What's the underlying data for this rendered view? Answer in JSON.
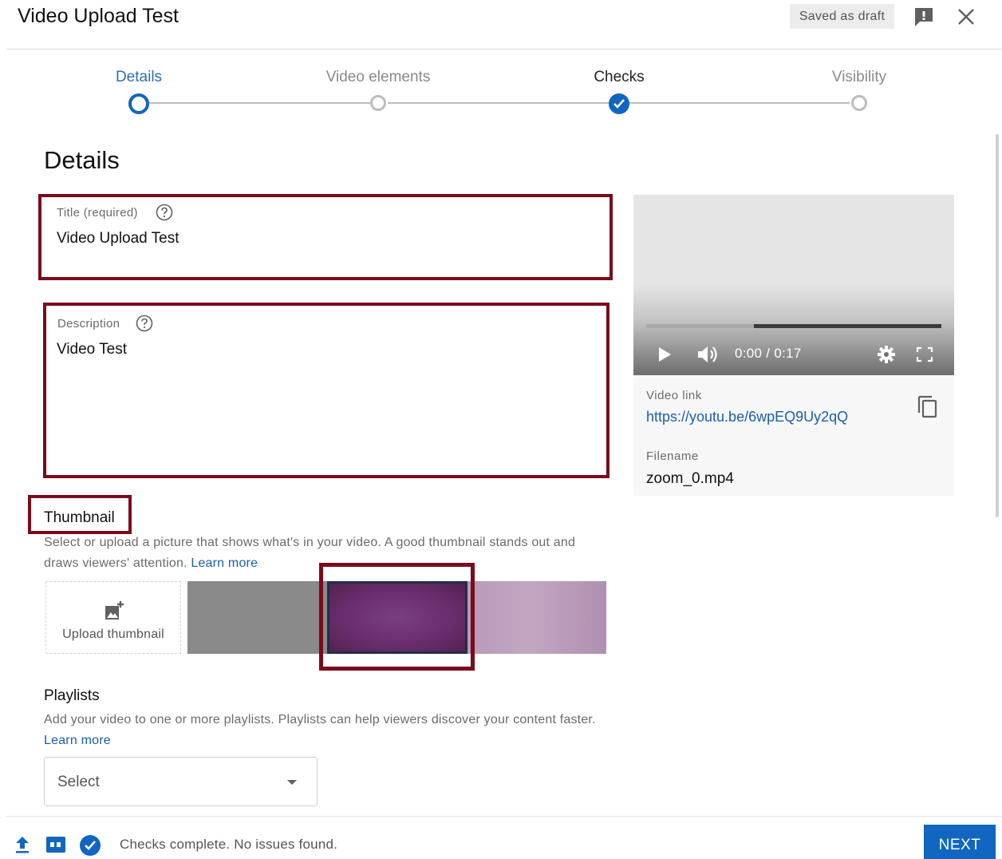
{
  "header": {
    "title": "Video Upload Test",
    "draft_status": "Saved as draft",
    "feedback_icon": "feedback-icon",
    "close_icon": "close-icon"
  },
  "stepper": {
    "steps": [
      {
        "label": "Details",
        "state": "current"
      },
      {
        "label": "Video elements",
        "state": "pending"
      },
      {
        "label": "Checks",
        "state": "complete"
      },
      {
        "label": "Visibility",
        "state": "pending"
      }
    ]
  },
  "details": {
    "heading": "Details",
    "title_field": {
      "label": "Title (required)",
      "value": "Video Upload Test",
      "icon": "help-icon"
    },
    "description_field": {
      "label": "Description",
      "value": "Video Test",
      "icon": "help-icon"
    }
  },
  "thumbnail": {
    "heading": "Thumbnail",
    "description": "Select or upload a picture that shows what's in your video. A good thumbnail stands out and draws viewers' attention.",
    "learn_more": "Learn more",
    "upload_label": "Upload thumbnail",
    "upload_icon": "add-photo-icon",
    "options": [
      {
        "color": "#8a8a8a",
        "selected": false
      },
      {
        "color": "#6a2e6f",
        "selected": true
      },
      {
        "color": "#c2a6c2",
        "selected": false
      }
    ]
  },
  "playlists": {
    "heading": "Playlists",
    "description": "Add your video to one or more playlists. Playlists can help viewers discover your content faster.",
    "learn_more": "Learn more",
    "select_value": "Select"
  },
  "video_panel": {
    "time": "0:00 / 0:17",
    "video_link_label": "Video link",
    "video_link": "https://youtu.be/6wpEQ9Uy2qQ",
    "filename_label": "Filename",
    "filename": "zoom_0.mp4"
  },
  "footer": {
    "status": "Checks complete. No issues found.",
    "next_label": "NEXT"
  },
  "colors": {
    "accent": "#1066c0",
    "highlight_box": "#7a0a1c",
    "link": "#1c5fa8"
  }
}
